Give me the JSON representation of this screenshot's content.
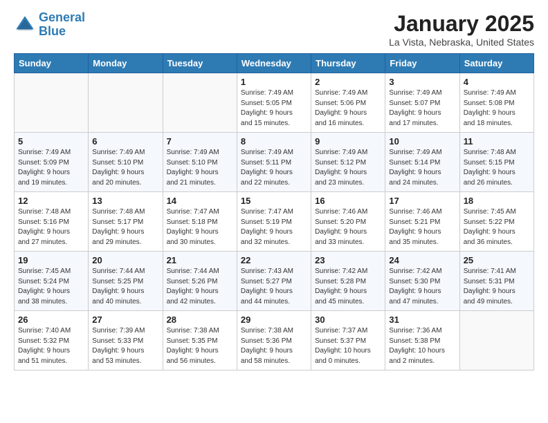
{
  "logo": {
    "line1": "General",
    "line2": "Blue"
  },
  "title": "January 2025",
  "location": "La Vista, Nebraska, United States",
  "weekdays": [
    "Sunday",
    "Monday",
    "Tuesday",
    "Wednesday",
    "Thursday",
    "Friday",
    "Saturday"
  ],
  "weeks": [
    [
      {
        "day": "",
        "info": ""
      },
      {
        "day": "",
        "info": ""
      },
      {
        "day": "",
        "info": ""
      },
      {
        "day": "1",
        "info": "Sunrise: 7:49 AM\nSunset: 5:05 PM\nDaylight: 9 hours\nand 15 minutes."
      },
      {
        "day": "2",
        "info": "Sunrise: 7:49 AM\nSunset: 5:06 PM\nDaylight: 9 hours\nand 16 minutes."
      },
      {
        "day": "3",
        "info": "Sunrise: 7:49 AM\nSunset: 5:07 PM\nDaylight: 9 hours\nand 17 minutes."
      },
      {
        "day": "4",
        "info": "Sunrise: 7:49 AM\nSunset: 5:08 PM\nDaylight: 9 hours\nand 18 minutes."
      }
    ],
    [
      {
        "day": "5",
        "info": "Sunrise: 7:49 AM\nSunset: 5:09 PM\nDaylight: 9 hours\nand 19 minutes."
      },
      {
        "day": "6",
        "info": "Sunrise: 7:49 AM\nSunset: 5:10 PM\nDaylight: 9 hours\nand 20 minutes."
      },
      {
        "day": "7",
        "info": "Sunrise: 7:49 AM\nSunset: 5:10 PM\nDaylight: 9 hours\nand 21 minutes."
      },
      {
        "day": "8",
        "info": "Sunrise: 7:49 AM\nSunset: 5:11 PM\nDaylight: 9 hours\nand 22 minutes."
      },
      {
        "day": "9",
        "info": "Sunrise: 7:49 AM\nSunset: 5:12 PM\nDaylight: 9 hours\nand 23 minutes."
      },
      {
        "day": "10",
        "info": "Sunrise: 7:49 AM\nSunset: 5:14 PM\nDaylight: 9 hours\nand 24 minutes."
      },
      {
        "day": "11",
        "info": "Sunrise: 7:48 AM\nSunset: 5:15 PM\nDaylight: 9 hours\nand 26 minutes."
      }
    ],
    [
      {
        "day": "12",
        "info": "Sunrise: 7:48 AM\nSunset: 5:16 PM\nDaylight: 9 hours\nand 27 minutes."
      },
      {
        "day": "13",
        "info": "Sunrise: 7:48 AM\nSunset: 5:17 PM\nDaylight: 9 hours\nand 29 minutes."
      },
      {
        "day": "14",
        "info": "Sunrise: 7:47 AM\nSunset: 5:18 PM\nDaylight: 9 hours\nand 30 minutes."
      },
      {
        "day": "15",
        "info": "Sunrise: 7:47 AM\nSunset: 5:19 PM\nDaylight: 9 hours\nand 32 minutes."
      },
      {
        "day": "16",
        "info": "Sunrise: 7:46 AM\nSunset: 5:20 PM\nDaylight: 9 hours\nand 33 minutes."
      },
      {
        "day": "17",
        "info": "Sunrise: 7:46 AM\nSunset: 5:21 PM\nDaylight: 9 hours\nand 35 minutes."
      },
      {
        "day": "18",
        "info": "Sunrise: 7:45 AM\nSunset: 5:22 PM\nDaylight: 9 hours\nand 36 minutes."
      }
    ],
    [
      {
        "day": "19",
        "info": "Sunrise: 7:45 AM\nSunset: 5:24 PM\nDaylight: 9 hours\nand 38 minutes."
      },
      {
        "day": "20",
        "info": "Sunrise: 7:44 AM\nSunset: 5:25 PM\nDaylight: 9 hours\nand 40 minutes."
      },
      {
        "day": "21",
        "info": "Sunrise: 7:44 AM\nSunset: 5:26 PM\nDaylight: 9 hours\nand 42 minutes."
      },
      {
        "day": "22",
        "info": "Sunrise: 7:43 AM\nSunset: 5:27 PM\nDaylight: 9 hours\nand 44 minutes."
      },
      {
        "day": "23",
        "info": "Sunrise: 7:42 AM\nSunset: 5:28 PM\nDaylight: 9 hours\nand 45 minutes."
      },
      {
        "day": "24",
        "info": "Sunrise: 7:42 AM\nSunset: 5:30 PM\nDaylight: 9 hours\nand 47 minutes."
      },
      {
        "day": "25",
        "info": "Sunrise: 7:41 AM\nSunset: 5:31 PM\nDaylight: 9 hours\nand 49 minutes."
      }
    ],
    [
      {
        "day": "26",
        "info": "Sunrise: 7:40 AM\nSunset: 5:32 PM\nDaylight: 9 hours\nand 51 minutes."
      },
      {
        "day": "27",
        "info": "Sunrise: 7:39 AM\nSunset: 5:33 PM\nDaylight: 9 hours\nand 53 minutes."
      },
      {
        "day": "28",
        "info": "Sunrise: 7:38 AM\nSunset: 5:35 PM\nDaylight: 9 hours\nand 56 minutes."
      },
      {
        "day": "29",
        "info": "Sunrise: 7:38 AM\nSunset: 5:36 PM\nDaylight: 9 hours\nand 58 minutes."
      },
      {
        "day": "30",
        "info": "Sunrise: 7:37 AM\nSunset: 5:37 PM\nDaylight: 10 hours\nand 0 minutes."
      },
      {
        "day": "31",
        "info": "Sunrise: 7:36 AM\nSunset: 5:38 PM\nDaylight: 10 hours\nand 2 minutes."
      },
      {
        "day": "",
        "info": ""
      }
    ]
  ]
}
